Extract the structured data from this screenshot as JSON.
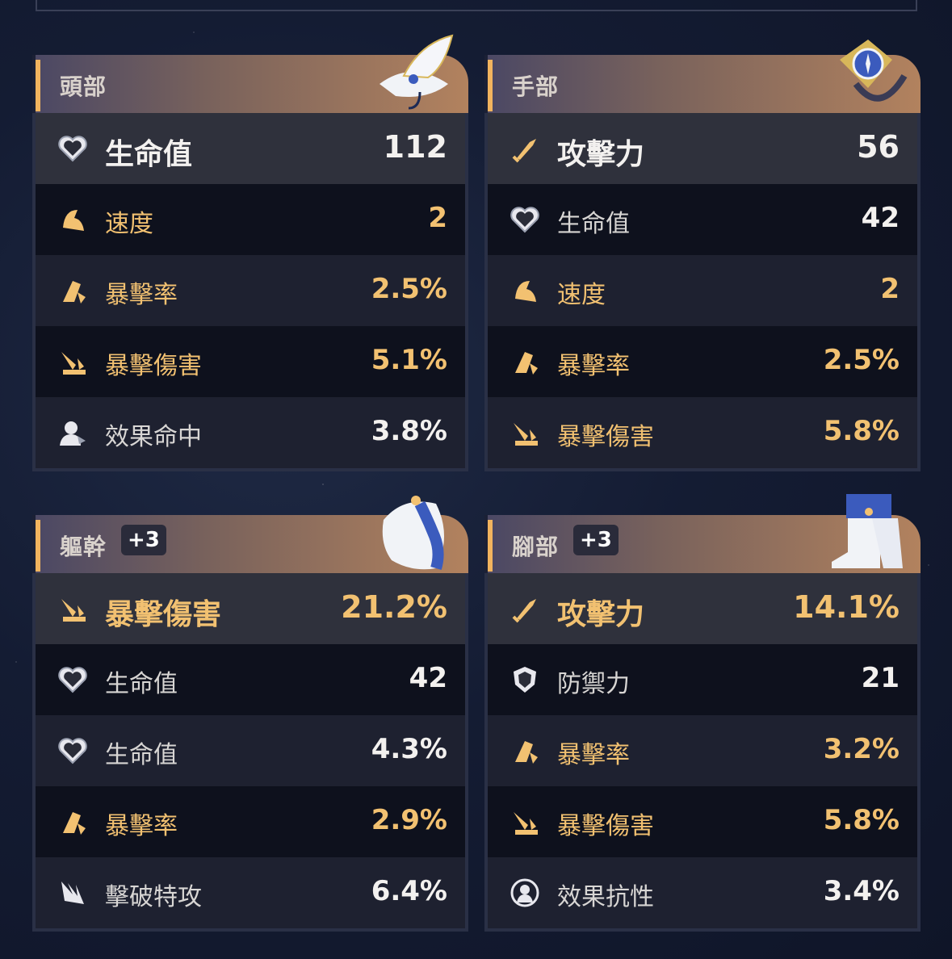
{
  "colors": {
    "accent_gold": "#f2c171",
    "header_bar": "#f2b45e"
  },
  "cards": [
    {
      "title": "頭部",
      "badge": "",
      "main": {
        "icon": "heart-icon",
        "label": "生命值",
        "value": "112",
        "gold": false
      },
      "subs": [
        {
          "icon": "speed-icon",
          "label": "速度",
          "value": "2",
          "gold": true
        },
        {
          "icon": "crit-rate-icon",
          "label": "暴擊率",
          "value": "2.5%",
          "gold": true
        },
        {
          "icon": "crit-dmg-icon",
          "label": "暴擊傷害",
          "value": "5.1%",
          "gold": true
        },
        {
          "icon": "effect-hit-icon",
          "label": "效果命中",
          "value": "3.8%",
          "gold": false
        }
      ]
    },
    {
      "title": "手部",
      "badge": "",
      "main": {
        "icon": "sword-icon",
        "label": "攻擊力",
        "value": "56",
        "gold": false
      },
      "subs": [
        {
          "icon": "heart-icon",
          "label": "生命值",
          "value": "42",
          "gold": false
        },
        {
          "icon": "speed-icon",
          "label": "速度",
          "value": "2",
          "gold": true
        },
        {
          "icon": "crit-rate-icon",
          "label": "暴擊率",
          "value": "2.5%",
          "gold": true
        },
        {
          "icon": "crit-dmg-icon",
          "label": "暴擊傷害",
          "value": "5.8%",
          "gold": true
        }
      ]
    },
    {
      "title": "軀幹",
      "badge": "+3",
      "main": {
        "icon": "crit-dmg-icon",
        "label": "暴擊傷害",
        "value": "21.2%",
        "gold": true
      },
      "subs": [
        {
          "icon": "heart-icon",
          "label": "生命值",
          "value": "42",
          "gold": false
        },
        {
          "icon": "heart-icon",
          "label": "生命值",
          "value": "4.3%",
          "gold": false
        },
        {
          "icon": "crit-rate-icon",
          "label": "暴擊率",
          "value": "2.9%",
          "gold": true
        },
        {
          "icon": "break-effect-icon",
          "label": "擊破特攻",
          "value": "6.4%",
          "gold": false
        }
      ]
    },
    {
      "title": "腳部",
      "badge": "+3",
      "main": {
        "icon": "sword-icon",
        "label": "攻擊力",
        "value": "14.1%",
        "gold": true
      },
      "subs": [
        {
          "icon": "shield-icon",
          "label": "防禦力",
          "value": "21",
          "gold": false
        },
        {
          "icon": "crit-rate-icon",
          "label": "暴擊率",
          "value": "3.2%",
          "gold": true
        },
        {
          "icon": "crit-dmg-icon",
          "label": "暴擊傷害",
          "value": "5.8%",
          "gold": true
        },
        {
          "icon": "effect-res-icon",
          "label": "效果抗性",
          "value": "3.4%",
          "gold": false
        }
      ]
    }
  ]
}
